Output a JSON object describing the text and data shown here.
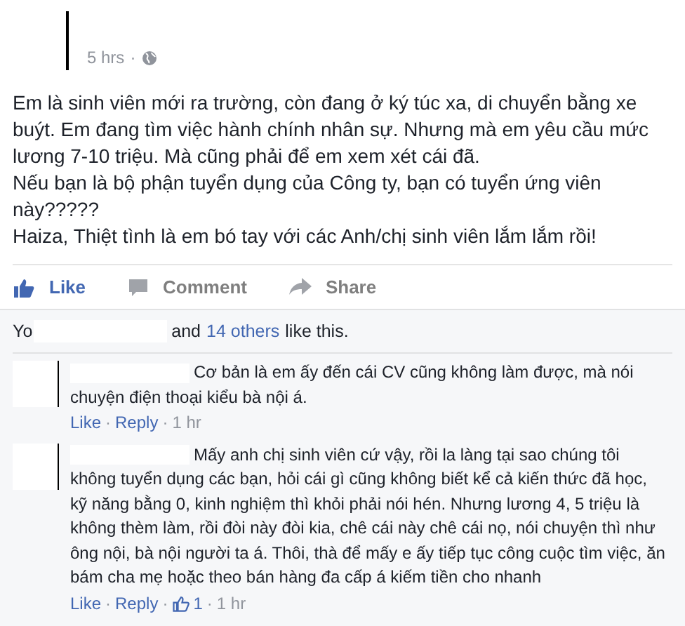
{
  "separator": "·",
  "post": {
    "time": "5 hrs",
    "paragraphs": [
      "Em là sinh viên mới ra trường, còn đang ở ký túc xa, di chuyển bằng xe buýt. Em đang tìm việc hành chính nhân sự. Nhưng mà em yêu cầu mức lương 7-10 triệu. Mà cũng phải để em xem xét cái đã.",
      "Nếu bạn là bộ phận tuyển dụng của Công ty, bạn có tuyển ứng viên này?????",
      "Haiza, Thiệt tình là em bó tay với các Anh/chị sinh viên lắm lắm rồi!"
    ]
  },
  "actions": [
    {
      "kind": "like",
      "label": "Like"
    },
    {
      "kind": "comment",
      "label": "Comment"
    },
    {
      "kind": "share",
      "label": "Share"
    }
  ],
  "likes": {
    "prefix": "Yo",
    "middle": "and",
    "others": "14 others",
    "suffix": "like this."
  },
  "comments": [
    {
      "text": "Cơ bản là em ấy đến cái CV cũng không làm được, mà nói chuyện điện thoại kiểu bà nội á.",
      "like": "Like",
      "reply": "Reply",
      "time": "1 hr"
    },
    {
      "text": "Mấy anh chị sinh viên cứ vậy, rồi la làng tại sao chúng tôi không tuyển dụng các bạn, hỏi cái gì cũng không biết kể cả kiến thức đã học, kỹ năng bằng 0, kinh nghiệm thì khỏi phải nói hén. Nhưng lương 4, 5 triệu là không thèm làm, rồi đòi này đòi kia, chê cái này chê cái nọ, nói chuyện thì như ông nội, bà nội người ta á. Thôi, thà để mấy e ấy tiếp tục công cuộc tìm việc, ăn bám cha mẹ hoặc theo bán hàng đa cấp á kiếm tiền cho nhanh",
      "like": "Like",
      "reply": "Reply",
      "reactions": "1",
      "time": "1 hr"
    }
  ]
}
